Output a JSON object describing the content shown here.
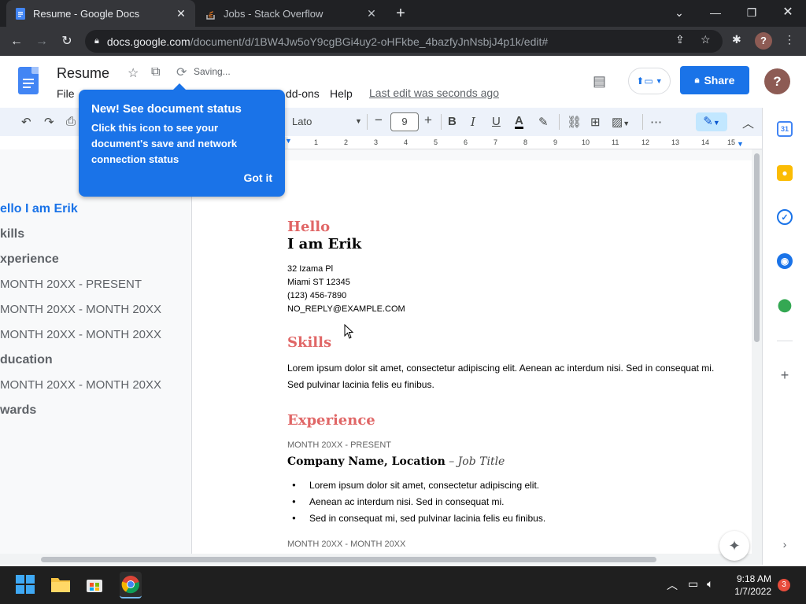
{
  "browser": {
    "tabs": [
      {
        "label": "Resume - Google Docs",
        "active": true
      },
      {
        "label": "Jobs - Stack Overflow",
        "active": false
      }
    ],
    "url_host": "docs.google.com",
    "url_path": "/document/d/1BW4Jw5oY9cgBGi4uy2-oHFkbe_4bazfyJnNsbjJ4p1k/edit#",
    "profile_initial": "?"
  },
  "docs": {
    "title": "Resume",
    "saving": "Saving...",
    "menus": [
      "File",
      "dd-ons",
      "Help"
    ],
    "last_edit": "Last edit was seconds ago",
    "share_label": "Share",
    "avatar_initial": "?"
  },
  "toolbar": {
    "font": "Lato",
    "size": "9"
  },
  "ruler_ticks": [
    "1",
    "1",
    "2",
    "3",
    "4",
    "5",
    "6",
    "7",
    "8",
    "9",
    "10",
    "11",
    "12",
    "13",
    "14",
    "15"
  ],
  "tooltip": {
    "title": "New! See document status",
    "body": "Click this icon to see your document's save and network connection status",
    "action": "Got it"
  },
  "outline": [
    {
      "text": "ello I am Erik",
      "level": 1,
      "active": true
    },
    {
      "text": "kills",
      "level": 1
    },
    {
      "text": "xperience",
      "level": 1
    },
    {
      "text": "MONTH 20XX - PRESENT",
      "level": 2
    },
    {
      "text": "MONTH 20XX - MONTH 20XX",
      "level": 2
    },
    {
      "text": "MONTH 20XX - MONTH 20XX",
      "level": 2
    },
    {
      "text": "ducation",
      "level": 1
    },
    {
      "text": "MONTH 20XX - MONTH 20XX",
      "level": 2
    },
    {
      "text": "wards",
      "level": 1
    }
  ],
  "document": {
    "hello": "Hello",
    "name": "I am Erik",
    "address1": "32 Izama Pl",
    "address2": "Miami ST 12345",
    "phone": "(123) 456-7890",
    "email": "NO_REPLY@EXAMPLE.COM",
    "skills_heading": "Skills",
    "skills_body": "Lorem ipsum dolor sit amet, consectetur adipiscing elit. Aenean ac interdum nisi. Sed in consequat mi. Sed pulvinar lacinia felis eu finibus.",
    "experience_heading": "Experience",
    "exp1_date": "MONTH 20XX - PRESENT",
    "exp1_company": "Company Name, Location",
    "exp1_sep": " – ",
    "exp1_title": "Job Title",
    "bullets": [
      "Lorem ipsum dolor sit amet, consectetur adipiscing elit.",
      "Aenean ac interdum nisi. Sed in consequat mi.",
      "Sed in consequat mi, sed pulvinar lacinia felis eu finibus."
    ],
    "exp2_date": "MONTH 20XX - MONTH 20XX"
  },
  "taskbar": {
    "time": "9:18 AM",
    "date": "1/7/2022",
    "notifications": "3"
  },
  "colors": {
    "accent": "#1a73e8",
    "heading": "#e06666"
  }
}
